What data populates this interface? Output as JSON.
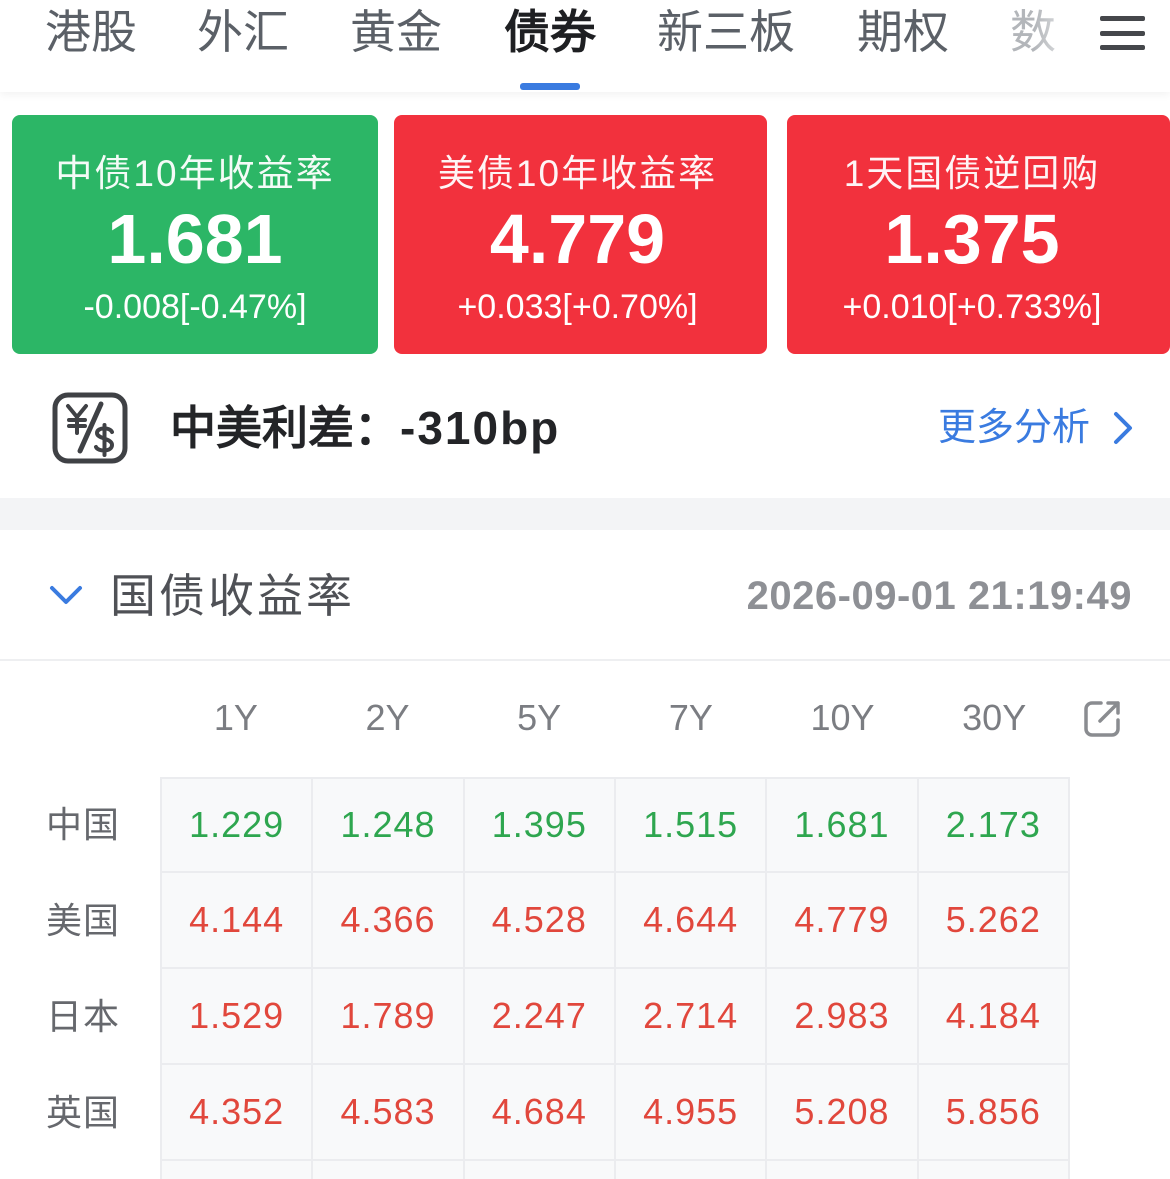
{
  "tabs": [
    {
      "label": "港股"
    },
    {
      "label": "外汇"
    },
    {
      "label": "黄金"
    },
    {
      "label": "债券",
      "active": true
    },
    {
      "label": "新三板"
    },
    {
      "label": "期权"
    },
    {
      "label": "数"
    }
  ],
  "icons": {
    "menu": "hamburger-menu-icon",
    "spread": "currency-exchange-icon",
    "more": "chevron-right-icon",
    "collapse": "chevron-down-icon",
    "expand_table": "external-link-icon"
  },
  "colors": {
    "accent": "#3a7be0"
  },
  "cards": [
    {
      "title": "中债10年收益率",
      "value": "1.681",
      "change": "-0.008[-0.47%]",
      "bg": "#2cb666"
    },
    {
      "title": "美债10年收益率",
      "value": "4.779",
      "change": "+0.033[+0.70%]",
      "bg": "#f2313d"
    },
    {
      "title": "1天国债逆回购",
      "value": "1.375",
      "change": "+0.010[+0.733%]",
      "bg": "#f2313d"
    }
  ],
  "spread": {
    "label": "中美利差：",
    "value": "-310bp",
    "more_label": "更多分析"
  },
  "yields": {
    "title": "国债收益率",
    "timestamp": "2026-09-01 21:19:49",
    "columns": [
      "1Y",
      "2Y",
      "5Y",
      "7Y",
      "10Y",
      "30Y"
    ],
    "rows": [
      {
        "country": "中国",
        "color": "#2ea64f",
        "values": [
          "1.229",
          "1.248",
          "1.395",
          "1.515",
          "1.681",
          "2.173"
        ]
      },
      {
        "country": "美国",
        "color": "#e1473c",
        "values": [
          "4.144",
          "4.366",
          "4.528",
          "4.644",
          "4.779",
          "5.262"
        ]
      },
      {
        "country": "日本",
        "color": "#e1473c",
        "values": [
          "1.529",
          "1.789",
          "2.247",
          "2.714",
          "2.983",
          "4.184"
        ]
      },
      {
        "country": "英国",
        "color": "#e1473c",
        "values": [
          "4.352",
          "4.583",
          "4.684",
          "4.955",
          "5.208",
          "5.856"
        ]
      }
    ]
  }
}
